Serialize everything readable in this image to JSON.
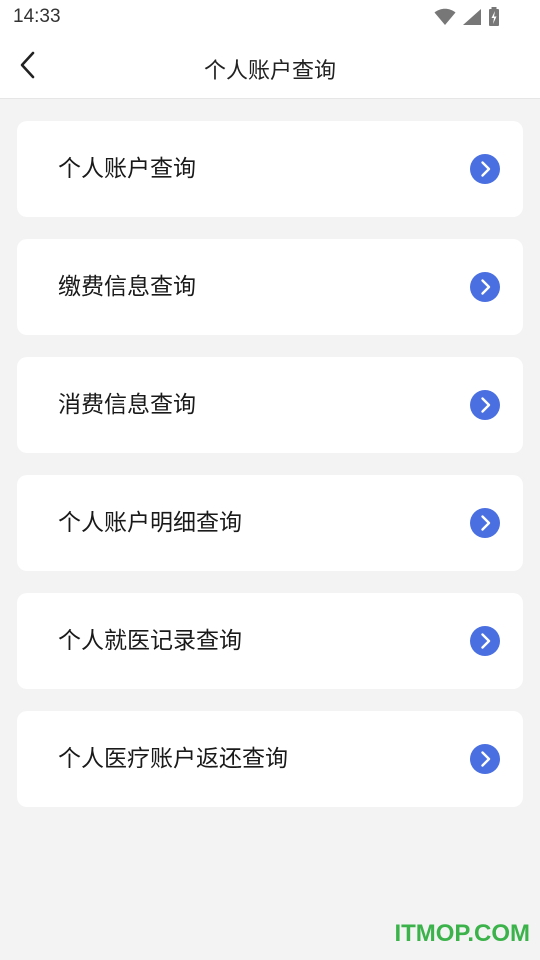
{
  "status_bar": {
    "time": "14:33",
    "icons": [
      "wifi-icon",
      "signal-icon",
      "battery-charging-icon"
    ]
  },
  "header": {
    "title": "个人账户查询",
    "back_icon": "chevron-left-icon"
  },
  "menu": {
    "items": [
      {
        "label": "个人账户查询",
        "icon": "chevron-right-circle-icon"
      },
      {
        "label": "缴费信息查询",
        "icon": "chevron-right-circle-icon"
      },
      {
        "label": "消费信息查询",
        "icon": "chevron-right-circle-icon"
      },
      {
        "label": "个人账户明细查询",
        "icon": "chevron-right-circle-icon"
      },
      {
        "label": "个人就医记录查询",
        "icon": "chevron-right-circle-icon"
      },
      {
        "label": "个人医疗账户返还查询",
        "icon": "chevron-right-circle-icon"
      }
    ]
  },
  "watermark": {
    "text": "ITMOP.COM"
  },
  "colors": {
    "background": "#f3f3f4",
    "card": "#ffffff",
    "accent": "#4a6fe0",
    "watermark": "#3bb34a"
  }
}
